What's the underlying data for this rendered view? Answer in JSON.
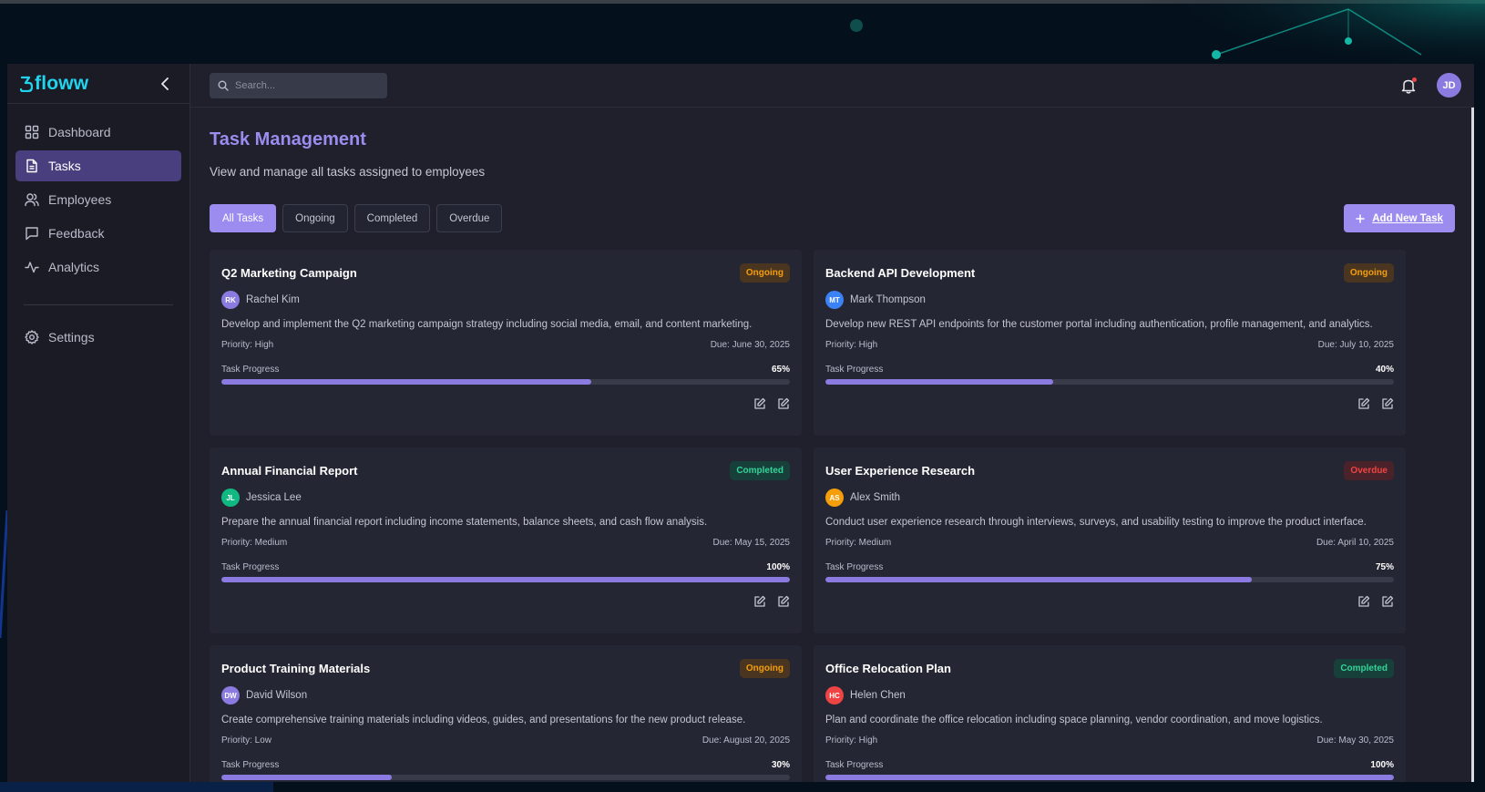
{
  "app": {
    "brand": "floww"
  },
  "sidebar": {
    "items": [
      {
        "label": "Dashboard",
        "icon": "grid-icon"
      },
      {
        "label": "Tasks",
        "icon": "document-icon",
        "active": true
      },
      {
        "label": "Employees",
        "icon": "users-icon"
      },
      {
        "label": "Feedback",
        "icon": "message-icon"
      },
      {
        "label": "Analytics",
        "icon": "activity-icon"
      }
    ],
    "settings": {
      "label": "Settings",
      "icon": "gear-icon"
    }
  },
  "topbar": {
    "search_placeholder": "Search...",
    "user_initials": "JD",
    "has_notification": true
  },
  "page": {
    "title": "Task Management",
    "subtitle": "View and manage all tasks assigned to employees"
  },
  "filters": [
    "All Tasks",
    "Ongoing",
    "Completed",
    "Overdue"
  ],
  "active_filter": "All Tasks",
  "add_button": "Add New Task",
  "progress_label": "Task Progress",
  "colors": {
    "accent": "#9d8cf0",
    "brand": "#22d3ee",
    "ongoing": "#f59e0b",
    "completed": "#34d399",
    "overdue": "#ef4444"
  },
  "tasks": [
    {
      "title": "Q2 Marketing Campaign",
      "status": "Ongoing",
      "status_class": "ongoing",
      "assignee": "Rachel Kim",
      "initials": "RK",
      "avatar_color": "#8b7be0",
      "description": "Develop and implement the Q2 marketing campaign strategy including social media, email, and content marketing.",
      "priority": "Priority: High",
      "due": "Due: June 30, 2025",
      "progress": 65,
      "progress_text": "65%"
    },
    {
      "title": "Backend API Development",
      "status": "Ongoing",
      "status_class": "ongoing",
      "assignee": "Mark Thompson",
      "initials": "MT",
      "avatar_color": "#3b82f6",
      "description": "Develop new REST API endpoints for the customer portal including authentication, profile management, and analytics.",
      "priority": "Priority: High",
      "due": "Due: July 10, 2025",
      "progress": 40,
      "progress_text": "40%"
    },
    {
      "title": "Annual Financial Report",
      "status": "Completed",
      "status_class": "completed",
      "assignee": "Jessica Lee",
      "initials": "JL",
      "avatar_color": "#10b981",
      "description": "Prepare the annual financial report including income statements, balance sheets, and cash flow analysis.",
      "priority": "Priority: Medium",
      "due": "Due: May 15, 2025",
      "progress": 100,
      "progress_text": "100%"
    },
    {
      "title": "User Experience Research",
      "status": "Overdue",
      "status_class": "overdue",
      "assignee": "Alex Smith",
      "initials": "AS",
      "avatar_color": "#f59e0b",
      "description": "Conduct user experience research through interviews, surveys, and usability testing to improve the product interface.",
      "priority": "Priority: Medium",
      "due": "Due: April 10, 2025",
      "progress": 75,
      "progress_text": "75%"
    },
    {
      "title": "Product Training Materials",
      "status": "Ongoing",
      "status_class": "ongoing",
      "assignee": "David Wilson",
      "initials": "DW",
      "avatar_color": "#8b7be0",
      "description": "Create comprehensive training materials including videos, guides, and presentations for the new product release.",
      "priority": "Priority: Low",
      "due": "Due: August 20, 2025",
      "progress": 30,
      "progress_text": "30%"
    },
    {
      "title": "Office Relocation Plan",
      "status": "Completed",
      "status_class": "completed",
      "assignee": "Helen Chen",
      "initials": "HC",
      "avatar_color": "#ef4444",
      "description": "Plan and coordinate the office relocation including space planning, vendor coordination, and move logistics.",
      "priority": "Priority: High",
      "due": "Due: May 30, 2025",
      "progress": 100,
      "progress_text": "100%"
    }
  ]
}
